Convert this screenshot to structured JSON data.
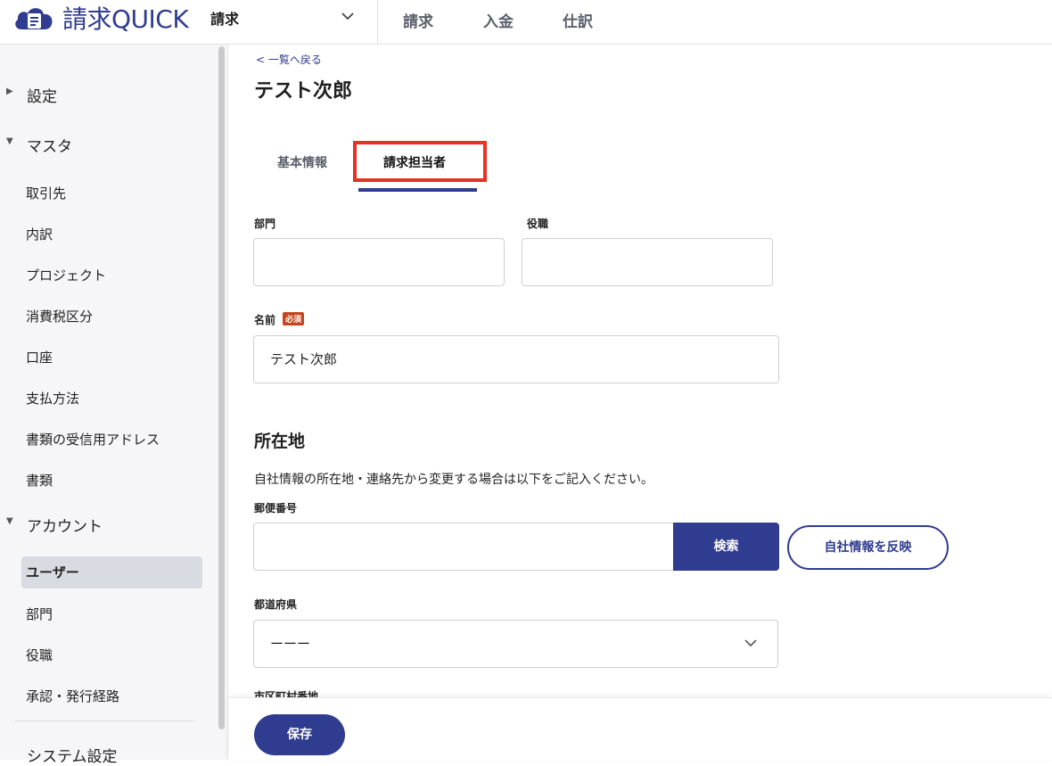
{
  "header": {
    "app_name": "請求QUICK",
    "module": "請求",
    "nav": [
      {
        "label": "請求"
      },
      {
        "label": "入金"
      },
      {
        "label": "仕訳"
      }
    ]
  },
  "sidebar": {
    "settings": "設定",
    "master": {
      "label": "マスタ",
      "items": [
        "取引先",
        "内訳",
        "プロジェクト",
        "消費税区分",
        "口座",
        "支払方法",
        "書類の受信用アドレス",
        "書類"
      ]
    },
    "account": {
      "label": "アカウント",
      "items": [
        "ユーザー",
        "部門",
        "役職",
        "承認・発行経路"
      ],
      "active": "ユーザー"
    },
    "system_settings": "システム設定"
  },
  "main": {
    "back_link": "< 一覧へ戻る",
    "title": "テスト次郎",
    "tabs": [
      {
        "label": "基本情報",
        "active": false
      },
      {
        "label": "請求担当者",
        "active": true
      }
    ],
    "fields": {
      "department": {
        "label": "部門",
        "value": ""
      },
      "position": {
        "label": "役職",
        "value": ""
      },
      "name": {
        "label": "名前",
        "required_badge": "必須",
        "value": "テスト次郎"
      }
    },
    "address": {
      "heading": "所在地",
      "description": "自社情報の所在地・連絡先から変更する場合は以下をご記入ください。",
      "postal_code": {
        "label": "郵便番号",
        "value": ""
      },
      "search_button": "検索",
      "reflect_button": "自社情報を反映",
      "prefecture": {
        "label": "都道府県",
        "value": "ーーー"
      },
      "next_label_partial": "市区町村番地"
    },
    "save_button": "保存"
  },
  "colors": {
    "primary": "#2f3c8f",
    "highlight": "#e53126",
    "required_badge": "#c4461d"
  }
}
